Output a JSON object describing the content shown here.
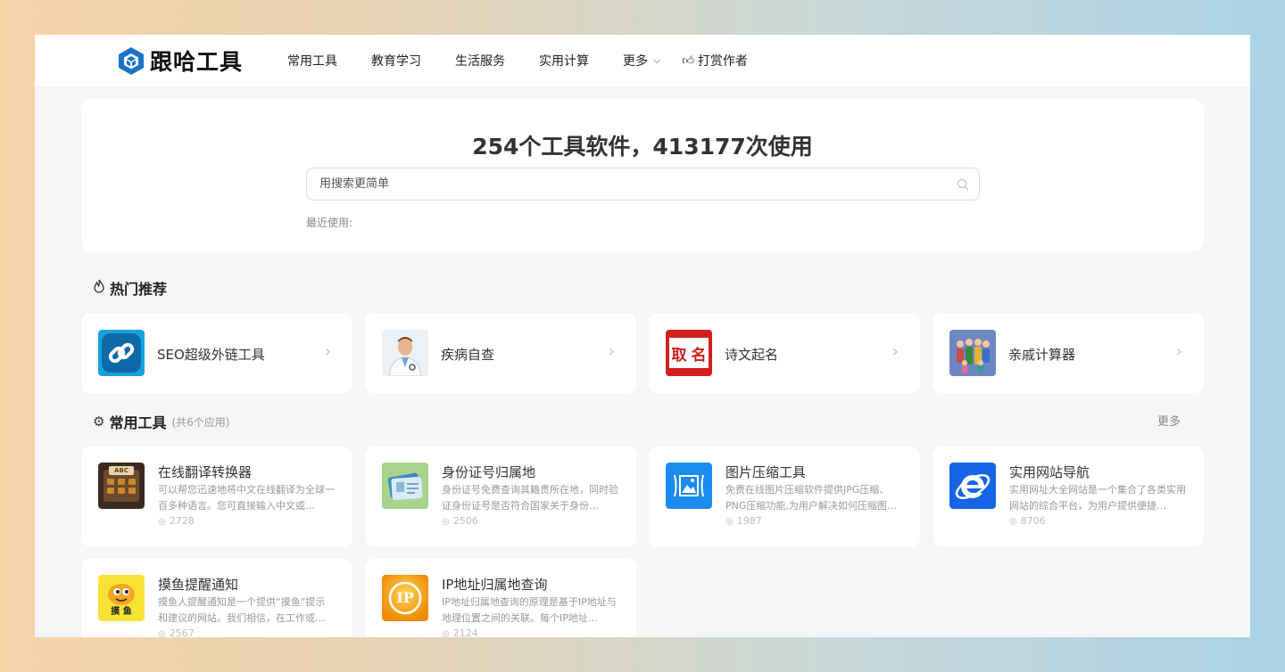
{
  "brand": {
    "name": "跟哈工具",
    "logo_color": "#1a73c8"
  },
  "nav": {
    "items": [
      {
        "label": "常用工具"
      },
      {
        "label": "教育学习"
      },
      {
        "label": "生活服务"
      },
      {
        "label": "实用计算"
      },
      {
        "label": "更多"
      }
    ],
    "tip_label": "打赏作者"
  },
  "hero": {
    "title": "254个工具软件，413177次使用",
    "search_placeholder": "用搜索更简单",
    "recent_label": "最近使用:"
  },
  "hot": {
    "title": "热门推荐",
    "items": [
      {
        "name": "SEO超级外链工具",
        "icon": "link-icon"
      },
      {
        "name": "疾病自查",
        "icon": "doctor-icon"
      },
      {
        "name": "诗文起名",
        "icon": "naming-icon"
      },
      {
        "name": "亲戚计算器",
        "icon": "family-icon"
      }
    ]
  },
  "common": {
    "title": "常用工具",
    "count_label": "(共6个应用)",
    "more_label": "更多",
    "items": [
      {
        "name": "在线翻译转换器",
        "desc": "可以帮您迅速地将中文在线翻译为全球一百多种语言。您可直接输入中文或…",
        "views": "2728",
        "icon": "abc-keyboard-icon"
      },
      {
        "name": "身份证号归属地",
        "desc": "身份证号免费查询其籍贯所在地，同时验证身份证号是否符合国家关于身份…",
        "views": "2506",
        "icon": "id-card-icon"
      },
      {
        "name": "图片压缩工具",
        "desc": "免费在线图片压缩软件提供JPG压缩、PNG压缩功能,为用户解决如何压缩图…",
        "views": "1987",
        "icon": "image-compress-icon"
      },
      {
        "name": "实用网站导航",
        "desc": "实用网址大全网站是一个集合了各类实用网站的综合平台，为用户提供便捷…",
        "views": "8706",
        "icon": "ie-browser-icon"
      },
      {
        "name": "摸鱼提醒通知",
        "desc": "摸鱼人提醒通知是一个提供“摸鱼”提示和建议的网站。我们相信，在工作或…",
        "views": "2567",
        "icon": "fish-icon"
      },
      {
        "name": "IP地址归属地查询",
        "desc": "IP地址归属地查询的原理是基于IP地址与地理位置之间的关联。每个IP地址…",
        "views": "2124",
        "icon": "ip-icon"
      }
    ]
  },
  "icon_labels": {
    "abc": "ABC",
    "fish": "摸 鱼",
    "naming_left": "取",
    "naming_right": "名",
    "ip": "IP"
  }
}
